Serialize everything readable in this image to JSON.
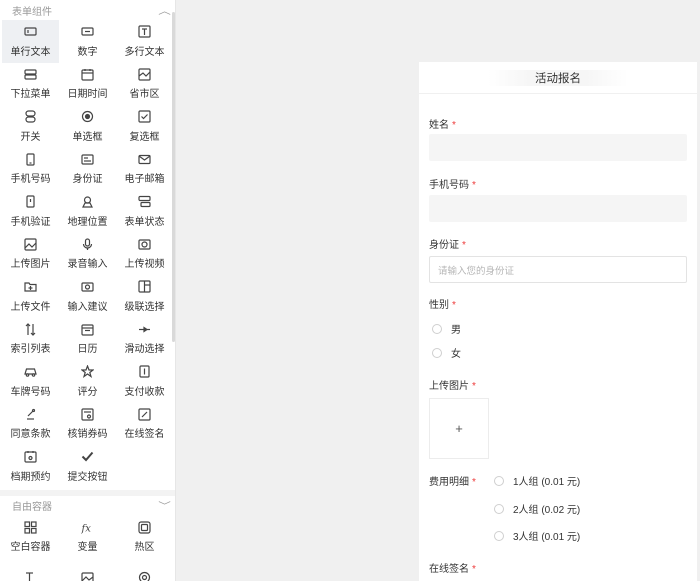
{
  "palette": {
    "section1": "表单组件",
    "section2": "自由容器",
    "items": [
      {
        "label": "单行文本",
        "icon": "single-line-text-icon"
      },
      {
        "label": "数字",
        "icon": "number-icon"
      },
      {
        "label": "多行文本",
        "icon": "multi-line-text-icon"
      },
      {
        "label": "下拉菜单",
        "icon": "dropdown-icon"
      },
      {
        "label": "日期时间",
        "icon": "calendar-icon"
      },
      {
        "label": "省市区",
        "icon": "region-map-icon"
      },
      {
        "label": "开关",
        "icon": "switch-icon"
      },
      {
        "label": "单选框",
        "icon": "radio-icon"
      },
      {
        "label": "复选框",
        "icon": "checkbox-icon"
      },
      {
        "label": "手机号码",
        "icon": "phone-icon"
      },
      {
        "label": "身份证",
        "icon": "id-card-icon"
      },
      {
        "label": "电子邮箱",
        "icon": "mail-icon"
      },
      {
        "label": "手机验证",
        "icon": "phone-verify-icon"
      },
      {
        "label": "地理位置",
        "icon": "location-icon"
      },
      {
        "label": "表单状态",
        "icon": "form-status-icon"
      },
      {
        "label": "上传图片",
        "icon": "image-upload-icon"
      },
      {
        "label": "录音输入",
        "icon": "microphone-icon"
      },
      {
        "label": "上传视频",
        "icon": "video-upload-icon"
      },
      {
        "label": "上传文件",
        "icon": "file-upload-icon"
      },
      {
        "label": "输入建议",
        "icon": "suggestion-icon"
      },
      {
        "label": "级联选择",
        "icon": "cascade-icon"
      },
      {
        "label": "索引列表",
        "icon": "index-list-icon"
      },
      {
        "label": "日历",
        "icon": "calendar-grid-icon"
      },
      {
        "label": "滑动选择",
        "icon": "slider-icon"
      },
      {
        "label": "车牌号码",
        "icon": "car-plate-icon"
      },
      {
        "label": "评分",
        "icon": "star-icon"
      },
      {
        "label": "支付收款",
        "icon": "payment-icon"
      },
      {
        "label": "同意条款",
        "icon": "agree-terms-icon"
      },
      {
        "label": "核销券码",
        "icon": "coupon-icon"
      },
      {
        "label": "在线签名",
        "icon": "signature-icon"
      },
      {
        "label": "档期预约",
        "icon": "schedule-icon"
      },
      {
        "label": "提交按钮",
        "icon": "check-icon"
      }
    ],
    "container_items": [
      {
        "label": "空白容器",
        "icon": "blank-container-icon"
      },
      {
        "label": "变量",
        "icon": "fx-icon"
      },
      {
        "label": "热区",
        "icon": "hotspot-icon"
      },
      {
        "label": "",
        "icon": "text-format-icon"
      },
      {
        "label": "",
        "icon": "image-icon"
      },
      {
        "label": "",
        "icon": "target-icon"
      }
    ]
  },
  "form": {
    "title": "活动报名",
    "name_label": "姓名",
    "phone_label": "手机号码",
    "id_label": "身份证",
    "id_placeholder": "请输入您的身份证",
    "gender_label": "性别",
    "gender_options": [
      "男",
      "女"
    ],
    "image_label": "上传图片",
    "upload_plus": "+",
    "fee_label": "费用明细",
    "fee_options": [
      "1人组 (0.01 元)",
      "2人组 (0.02 元)",
      "3人组 (0.01 元)"
    ],
    "signature_label": "在线签名",
    "required_mark": "*"
  },
  "colors": {
    "required": "#ee3a3a",
    "canvas": "#f0f0f0",
    "active_tile": "#eef0f3"
  }
}
